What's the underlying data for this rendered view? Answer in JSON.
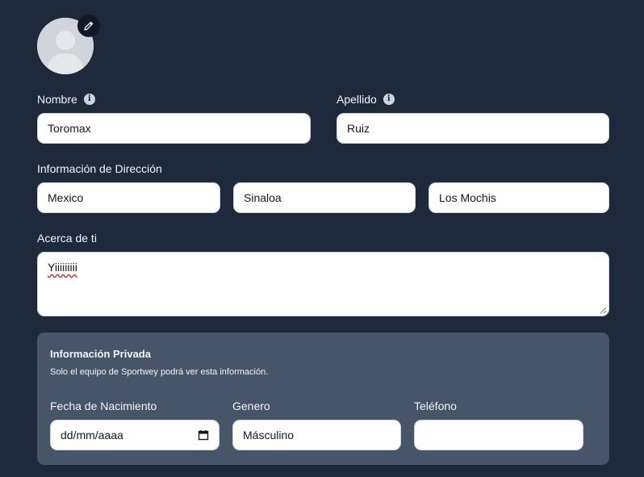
{
  "profile": {
    "avatar_icon": "user-silhouette-icon",
    "edit_icon": "pencil-icon"
  },
  "fields": {
    "nombre": {
      "label": "Nombre",
      "value": "Toromax"
    },
    "apellido": {
      "label": "Apellido",
      "value": "Ruiz"
    },
    "direccion": {
      "label": "Información de Dirección",
      "country": "Mexico",
      "state": "Sinaloa",
      "city": "Los Mochis"
    },
    "acerca": {
      "label": "Acerca de ti",
      "value": "Yiiiiiiiii"
    }
  },
  "private": {
    "title": "Información Privada",
    "subtitle": "Solo el equipo de Sportwey podrá ver esta información.",
    "fecha": {
      "label": "Fecha de Nacimiento",
      "placeholder": "dd/mm/aaaa"
    },
    "genero": {
      "label": "Genero",
      "value": "Másculino"
    },
    "telefono": {
      "label": "Teléfono",
      "value": ""
    }
  },
  "colors": {
    "background": "#1e293b",
    "panel": "#475569",
    "input_bg": "#ffffff",
    "info_icon": "#cbd5e1",
    "spellcheck": "#dc2626"
  }
}
